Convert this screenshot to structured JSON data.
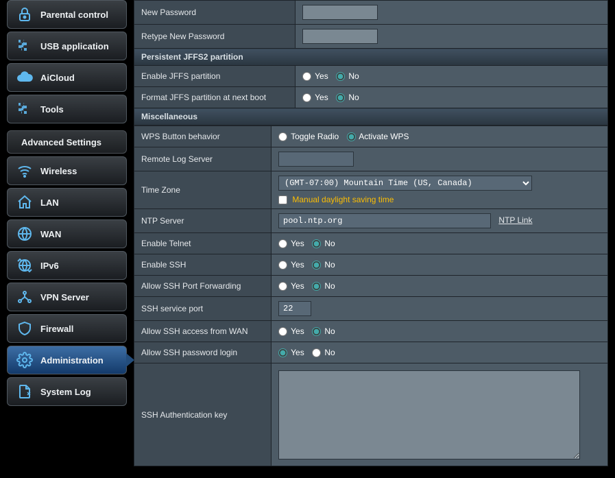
{
  "sidebar": {
    "top_items": [
      {
        "label": "Parental control"
      },
      {
        "label": "USB application"
      },
      {
        "label": "AiCloud"
      },
      {
        "label": "Tools"
      }
    ],
    "advanced_header": "Advanced Settings",
    "adv_items": [
      {
        "label": "Wireless"
      },
      {
        "label": "LAN"
      },
      {
        "label": "WAN"
      },
      {
        "label": "IPv6"
      },
      {
        "label": "VPN Server"
      },
      {
        "label": "Firewall"
      },
      {
        "label": "Administration"
      },
      {
        "label": "System Log"
      }
    ]
  },
  "password": {
    "new_label": "New Password",
    "retype_label": "Retype New Password"
  },
  "jffs2": {
    "section": "Persistent JFFS2 partition",
    "enable_label": "Enable JFFS partition",
    "format_label": "Format JFFS partition at next boot"
  },
  "misc": {
    "section": "Miscellaneous",
    "wps_label": "WPS Button behavior",
    "wps_toggle": "Toggle Radio",
    "wps_activate": "Activate WPS",
    "rlog_label": "Remote Log Server",
    "tz_label": "Time Zone",
    "tz_value": "(GMT-07:00) Mountain Time (US, Canada)",
    "dst_label": "Manual daylight saving time",
    "ntp_label": "NTP Server",
    "ntp_value": "pool.ntp.org",
    "ntp_link": "NTP Link",
    "telnet_label": "Enable Telnet",
    "ssh_label": "Enable SSH",
    "ssh_fwd_label": "Allow SSH Port Forwarding",
    "ssh_port_label": "SSH service port",
    "ssh_port_value": "22",
    "ssh_wan_label": "Allow SSH access from WAN",
    "ssh_pwlogin_label": "Allow SSH password login",
    "ssh_authkey_label": "SSH Authentication key"
  },
  "radio": {
    "yes": "Yes",
    "no": "No"
  }
}
